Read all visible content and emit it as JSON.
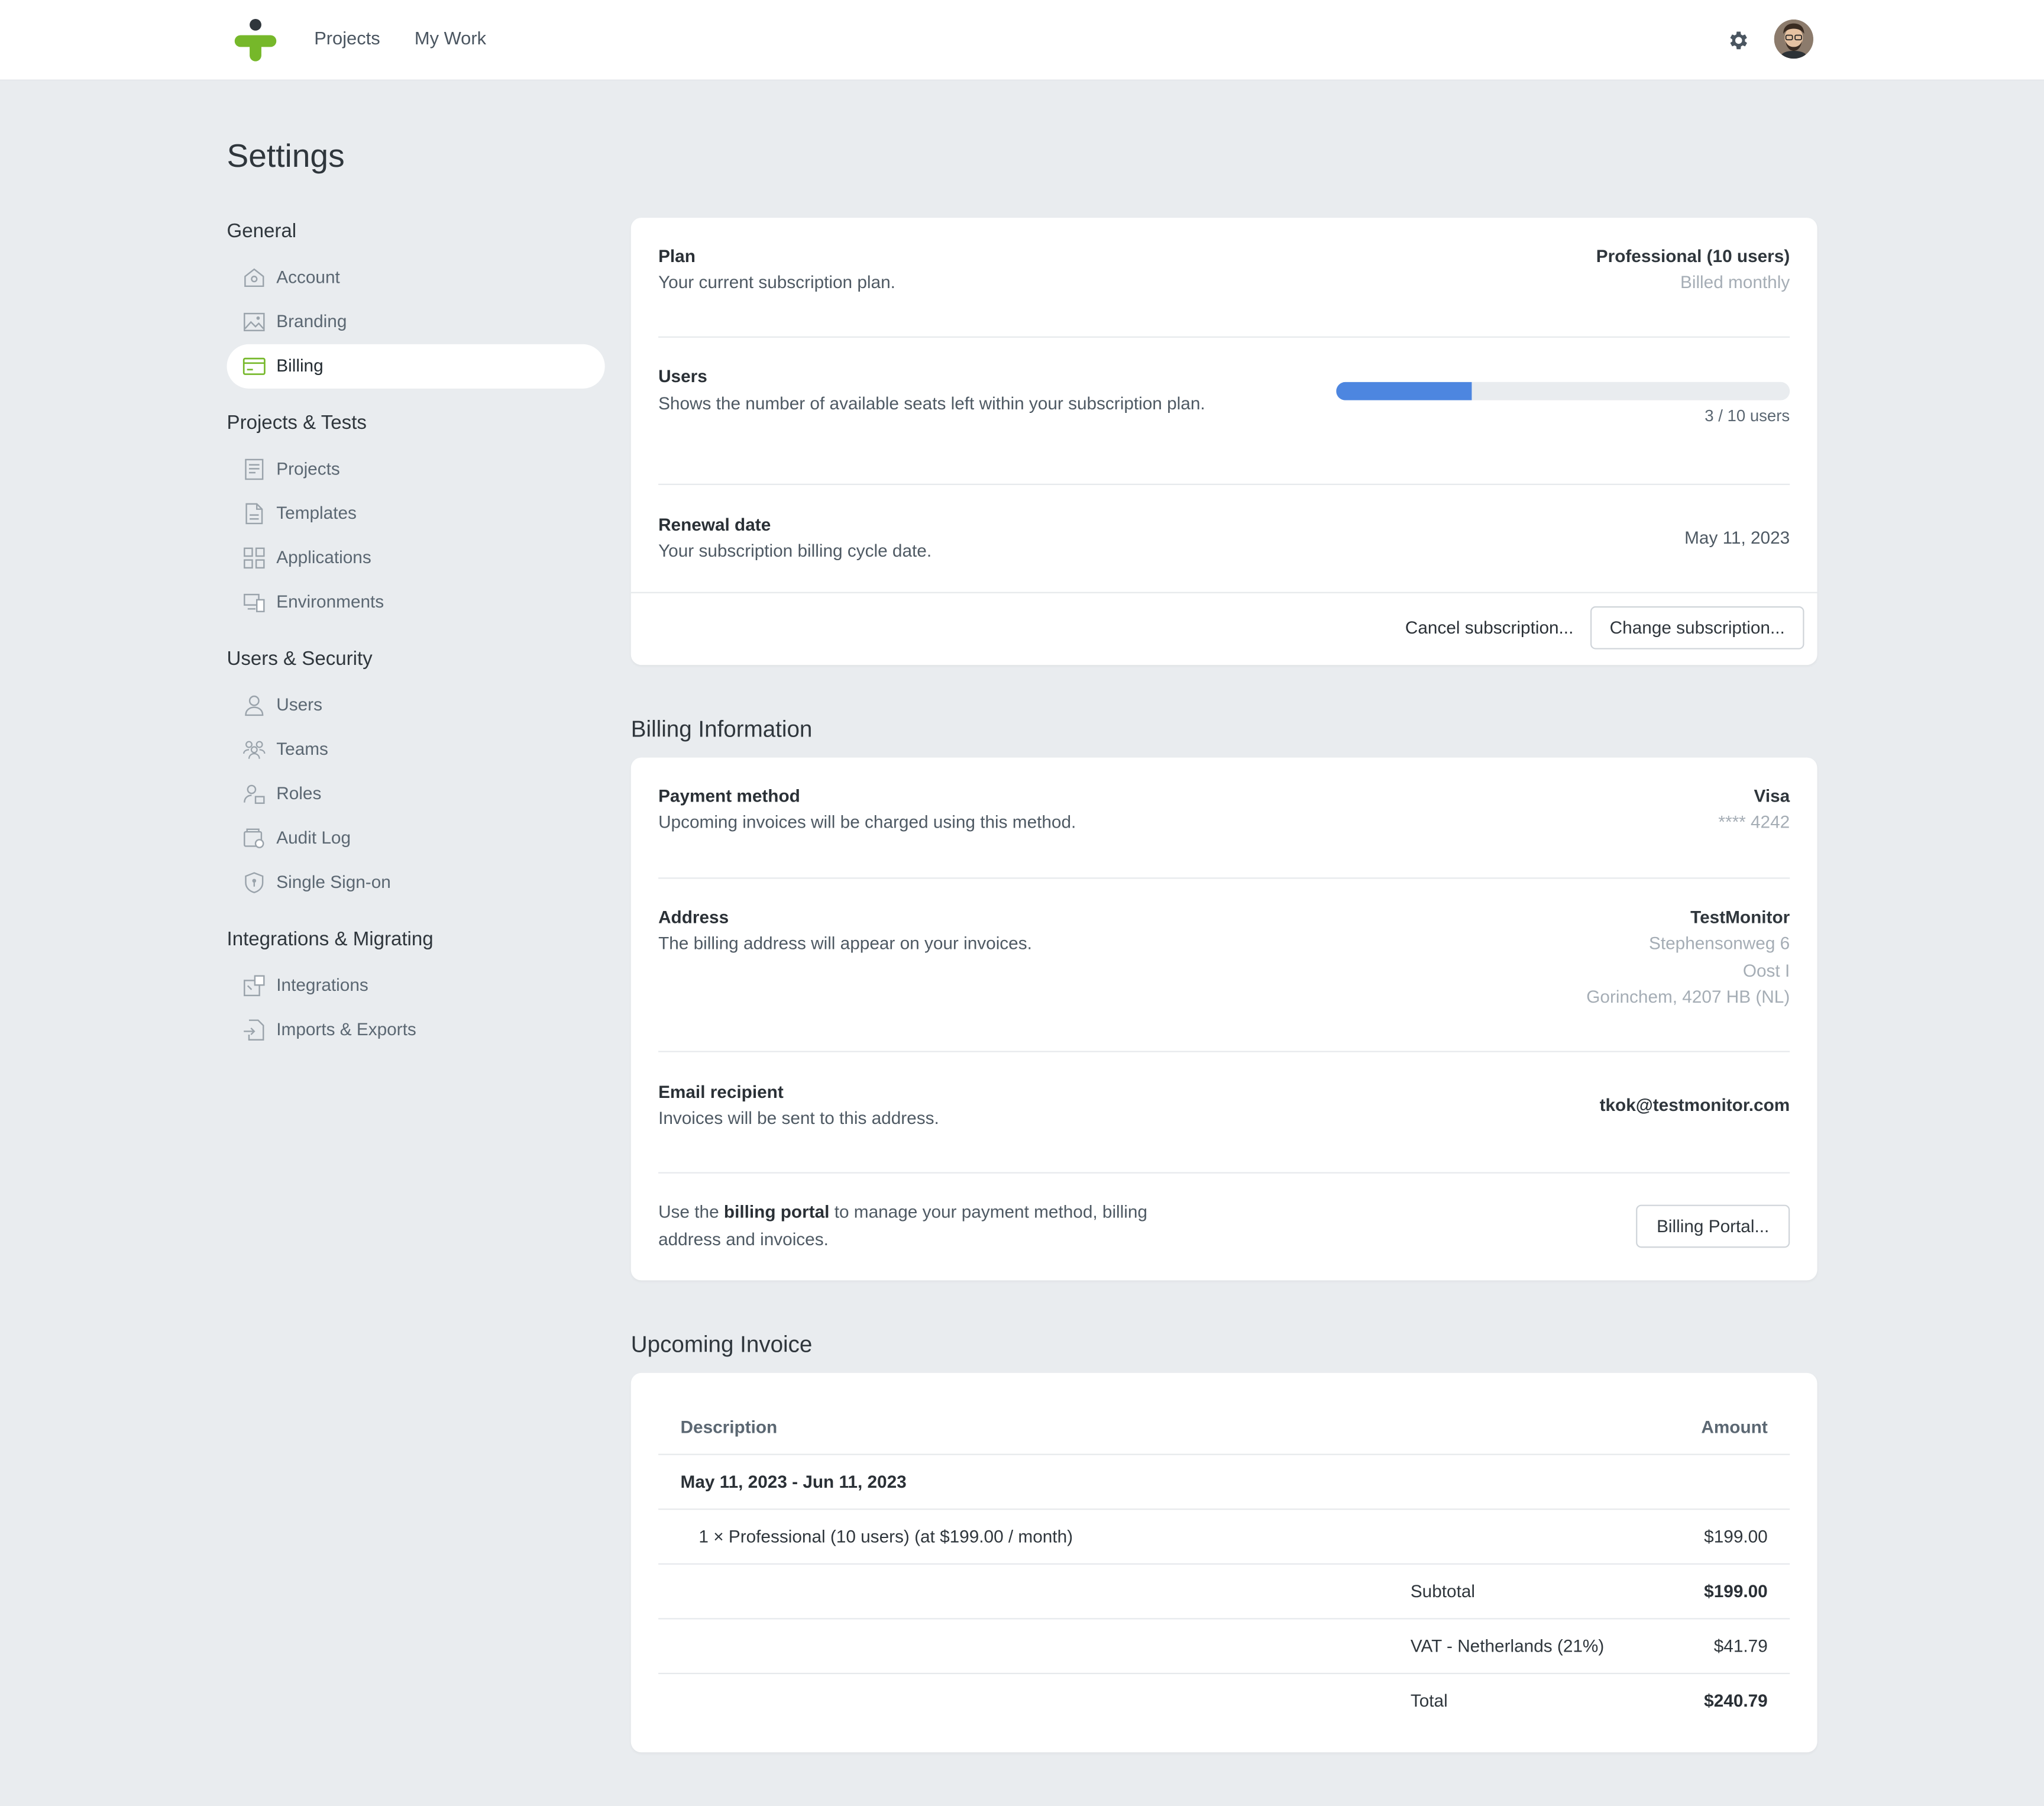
{
  "header": {
    "nav": [
      "Projects",
      "My Work"
    ],
    "logo_icon": "testmonitor-logo",
    "settings_icon": "gear-icon",
    "avatar_icon": "user-avatar"
  },
  "page": {
    "title": "Settings"
  },
  "sidebar": {
    "groups": [
      {
        "label": "General",
        "items": [
          {
            "label": "Account",
            "icon": "home-icon"
          },
          {
            "label": "Branding",
            "icon": "image-icon"
          },
          {
            "label": "Billing",
            "icon": "credit-card-icon",
            "active": true
          }
        ]
      },
      {
        "label": "Projects & Tests",
        "items": [
          {
            "label": "Projects",
            "icon": "document-list-icon"
          },
          {
            "label": "Templates",
            "icon": "file-icon"
          },
          {
            "label": "Applications",
            "icon": "grid-icon"
          },
          {
            "label": "Environments",
            "icon": "devices-icon"
          }
        ]
      },
      {
        "label": "Users & Security",
        "items": [
          {
            "label": "Users",
            "icon": "user-icon"
          },
          {
            "label": "Teams",
            "icon": "team-icon"
          },
          {
            "label": "Roles",
            "icon": "role-icon"
          },
          {
            "label": "Audit Log",
            "icon": "audit-icon"
          },
          {
            "label": "Single Sign-on",
            "icon": "shield-icon"
          }
        ]
      },
      {
        "label": "Integrations & Migrating",
        "items": [
          {
            "label": "Integrations",
            "icon": "puzzle-icon"
          },
          {
            "label": "Imports & Exports",
            "icon": "import-export-icon"
          }
        ]
      }
    ]
  },
  "subscription": {
    "plan": {
      "title": "Plan",
      "desc": "Your current subscription plan.",
      "value": "Professional (10 users)",
      "sub": "Billed monthly"
    },
    "users": {
      "title": "Users",
      "desc": "Shows the number of available seats left within your subscription plan.",
      "used": 3,
      "total": 10,
      "fill_fraction": 0.3,
      "caption": "3 / 10 users"
    },
    "renewal": {
      "title": "Renewal date",
      "desc": "Your subscription billing cycle date.",
      "value": "May 11, 2023"
    },
    "cancel_label": "Cancel subscription...",
    "change_label": "Change subscription..."
  },
  "billing": {
    "heading": "Billing Information",
    "payment": {
      "title": "Payment method",
      "desc": "Upcoming invoices will be charged using this method.",
      "value": "Visa",
      "sub": "**** 4242"
    },
    "address": {
      "title": "Address",
      "desc": "The billing address will appear on your invoices.",
      "value": "TestMonitor",
      "lines": [
        "Stephensonweg 6",
        "Oost I",
        "Gorinchem, 4207 HB (NL)"
      ]
    },
    "email": {
      "title": "Email recipient",
      "desc": "Invoices will be sent to this address.",
      "value": "tkok@testmonitor.com"
    },
    "portal": {
      "text_before": "Use the ",
      "text_bold": "billing portal",
      "text_after": " to manage your payment method, billing address and invoices.",
      "button": "Billing Portal..."
    }
  },
  "invoice": {
    "heading": "Upcoming Invoice",
    "columns": [
      "Description",
      "Amount"
    ],
    "period": "May 11, 2023 - Jun 11, 2023",
    "line": {
      "desc": "1 × Professional (10 users) (at $199.00 / month)",
      "amount": "$199.00"
    },
    "subtotal": {
      "label": "Subtotal",
      "amount": "$199.00"
    },
    "vat": {
      "label": "VAT - Netherlands (21%)",
      "amount": "$41.79"
    },
    "total": {
      "label": "Total",
      "amount": "$240.79"
    }
  },
  "colors": {
    "accent": "#4d86e0",
    "brand_green": "#76b82a",
    "background": "#e9ecef"
  }
}
